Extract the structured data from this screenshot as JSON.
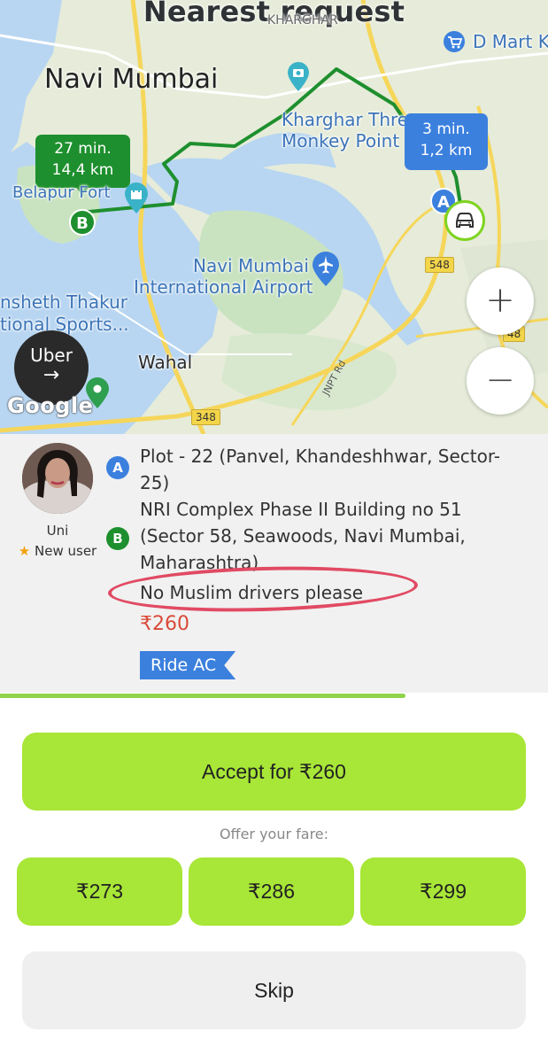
{
  "map": {
    "title": "Nearest request",
    "city": "Navi Mumbai",
    "places": {
      "kharghar": "KHARGHAR",
      "dmart": "D Mart K",
      "three_monkey_1": "Kharghar Thre",
      "three_monkey_2": "Monkey Point",
      "belapur": "Belapur Fort",
      "airport_1": "Navi Mumbai",
      "airport_2": "International Airport",
      "dy_1": "nsheth Thakur",
      "dy_2": "tional Sports...",
      "wahal": "Wahal"
    },
    "road_badges": [
      "548",
      "348",
      "48"
    ],
    "road_label": "JNPT Rd",
    "pickup_bubble": {
      "time": "3 min.",
      "distance": "1,2 km"
    },
    "drop_bubble": {
      "time": "27 min.",
      "distance": "14,4 km"
    },
    "pin_a": "A",
    "pin_b": "B",
    "zoom_in": "+",
    "zoom_out": "−",
    "uber_label": "Uber",
    "uber_arrow": "→",
    "google_logo": "Google",
    "colors": {
      "route": "#1e8f2e",
      "pickup": "#3c80de",
      "water": "#b8d6f2",
      "land": "#e6ecd9",
      "green_area": "#c9e3c0",
      "road": "#f6d65a"
    }
  },
  "request": {
    "user_name": "Uni",
    "user_badge": "New user",
    "star_icon": "★",
    "pickup_label": "A",
    "pickup_address": "Plot - 22 (Panvel, Khandeshhwar, Sector-25)",
    "dropoff_label": "B",
    "dropoff_address": "NRI Complex Phase II Building no 51 (Sector 58, Seawoods, Navi Mumbai, Maharashtra)",
    "note": "No Muslim drivers please",
    "price": "₹260",
    "ride_type": "Ride AC",
    "timer_progress": 0.74
  },
  "actions": {
    "accept_label": "Accept for ₹260",
    "offer_label": "Offer your fare:",
    "fares": [
      "₹273",
      "₹286",
      "₹299"
    ],
    "skip_label": "Skip",
    "accent": "#a8e637"
  }
}
